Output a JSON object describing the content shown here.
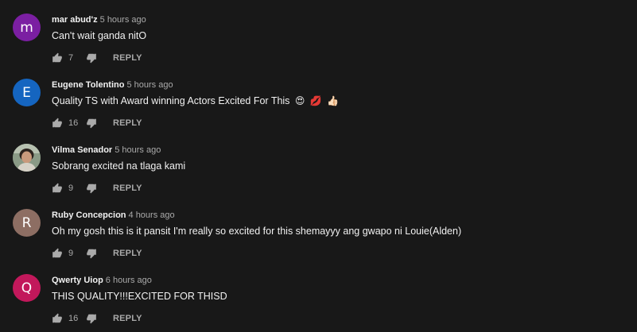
{
  "comments": [
    {
      "avatar_letter": "m",
      "avatar_color": "#7b1fa2",
      "author": "mar abud'z",
      "time": "5 hours ago",
      "text": "Can't wait ganda nitO",
      "likes": "7",
      "reply_label": "REPLY"
    },
    {
      "avatar_letter": "E",
      "avatar_color": "#1565c0",
      "author": "Eugene Tolentino",
      "time": "5 hours ago",
      "text": "Quality TS with Award winning Actors Excited For This",
      "emojis": [
        "😍",
        "💋",
        "👍🏻"
      ],
      "likes": "16",
      "reply_label": "REPLY"
    },
    {
      "avatar_letter": "",
      "avatar_color": "#7c8a76",
      "author": "Vilma Senador",
      "time": "5 hours ago",
      "text": "Sobrang excited na tlaga kami",
      "likes": "9",
      "reply_label": "REPLY"
    },
    {
      "avatar_letter": "R",
      "avatar_color": "#8d6e63",
      "author": "Ruby Concepcion",
      "time": "4 hours ago",
      "text": "Oh my gosh this is it pansit I'm really so excited for this shemayyy ang gwapo ni Louie(Alden)",
      "likes": "9",
      "reply_label": "REPLY"
    },
    {
      "avatar_letter": "Q",
      "avatar_color": "#c2185b",
      "author": "Qwerty Uiop",
      "time": "6 hours ago",
      "text": "THIS QUALITY!!!EXCITED FOR THISD",
      "likes": "16",
      "reply_label": "REPLY"
    }
  ]
}
